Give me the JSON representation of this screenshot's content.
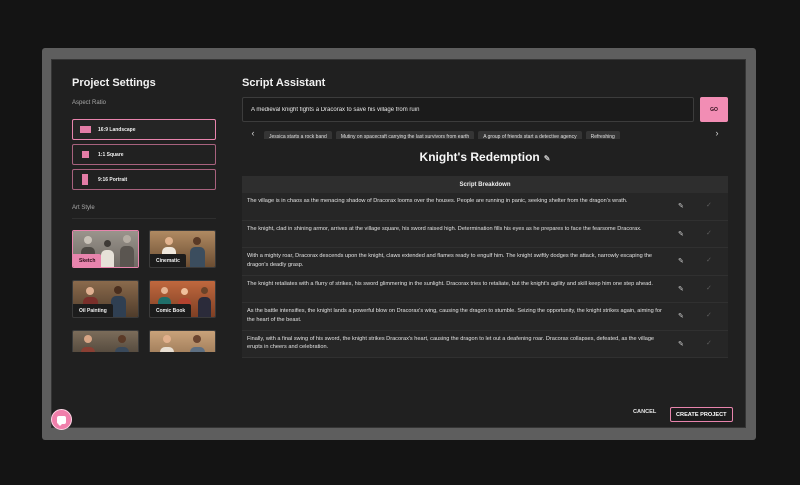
{
  "project_settings": {
    "title": "Project Settings",
    "aspect_ratio_label": "Aspect Ratio",
    "aspect_ratios": [
      {
        "label": "16:9 Landscape",
        "selected": true
      },
      {
        "label": "1:1 Square",
        "selected": false
      },
      {
        "label": "9:16 Portrait",
        "selected": false
      }
    ],
    "art_style_label": "Art Style",
    "art_styles": [
      {
        "label": "Sketch",
        "selected": true
      },
      {
        "label": "Cinematic",
        "selected": false
      },
      {
        "label": "Oil Painting",
        "selected": false
      },
      {
        "label": "Comic Book",
        "selected": false
      },
      {
        "label": "",
        "selected": false
      },
      {
        "label": "",
        "selected": false
      }
    ]
  },
  "script_assistant": {
    "title": "Script Assistant",
    "prompt_value": "A medieval knight fights a Dracorax to save his village from ruin",
    "go_label": "GO",
    "suggestions": [
      "Jessica starts a rock band",
      "Mutiny on spacecraft carrying the last survivors from earth",
      "A group of friends start a detective agency",
      "Refreshing"
    ],
    "story_title": "Knight's Redemption",
    "breakdown_header": "Script Breakdown",
    "breakdown": [
      "The village is in chaos as the menacing shadow of Dracorax looms over the houses. People are running in panic, seeking shelter from the dragon's wrath.",
      "The knight, clad in shining armor, arrives at the village square, his sword raised high. Determination fills his eyes as he prepares to face the fearsome Dracorax.",
      "With a mighty roar, Dracorax descends upon the knight, claws extended and flames ready to engulf him. The knight swiftly dodges the attack, narrowly escaping the dragon's deadly grasp.",
      "The knight retaliates with a flurry of strikes, his sword glimmering in the sunlight. Dracorax tries to retaliate, but the knight's agility and skill keep him one step ahead.",
      "As the battle intensifies, the knight lands a powerful blow on Dracorax's wing, causing the dragon to stumble. Seizing the opportunity, the knight strikes again, aiming for the heart of the beast.",
      "Finally, with a final swing of his sword, the knight strikes Dracorax's heart, causing the dragon to let out a deafening roar. Dracorax collapses, defeated, as the village erupts in cheers and celebration."
    ]
  },
  "footer": {
    "cancel_label": "CANCEL",
    "create_label": "CREATE PROJECT"
  },
  "icons": {
    "edit": "pencil-icon",
    "confirm": "check-icon",
    "prev": "chevron-left-icon",
    "next": "chevron-right-icon",
    "chat": "chat-bubble-icon"
  },
  "colors": {
    "accent": "#f28db4",
    "background": "#202020",
    "backdrop": "#141414"
  }
}
